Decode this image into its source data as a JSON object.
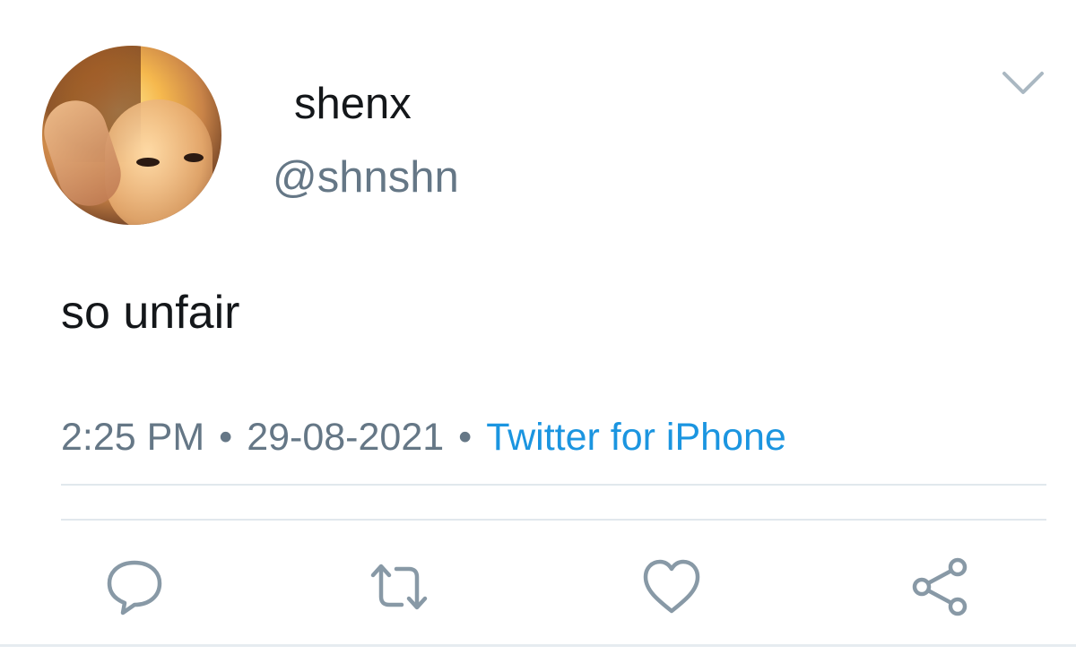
{
  "tweet": {
    "author": {
      "display_name": "shenx",
      "handle": "@shnshn"
    },
    "text": "so unfair",
    "time": "2:25 PM",
    "date": "29-08-2021",
    "separator": "•",
    "source": "Twitter for iPhone"
  },
  "icons": {
    "menu": "chevron-down-icon",
    "reply": "reply-icon",
    "retweet": "retweet-icon",
    "like": "heart-icon",
    "share": "share-icon"
  },
  "colors": {
    "text_primary": "#14171a",
    "text_secondary": "#657786",
    "link": "#1b95e0",
    "icon": "#8899a6",
    "divider": "#e1e8ed"
  }
}
